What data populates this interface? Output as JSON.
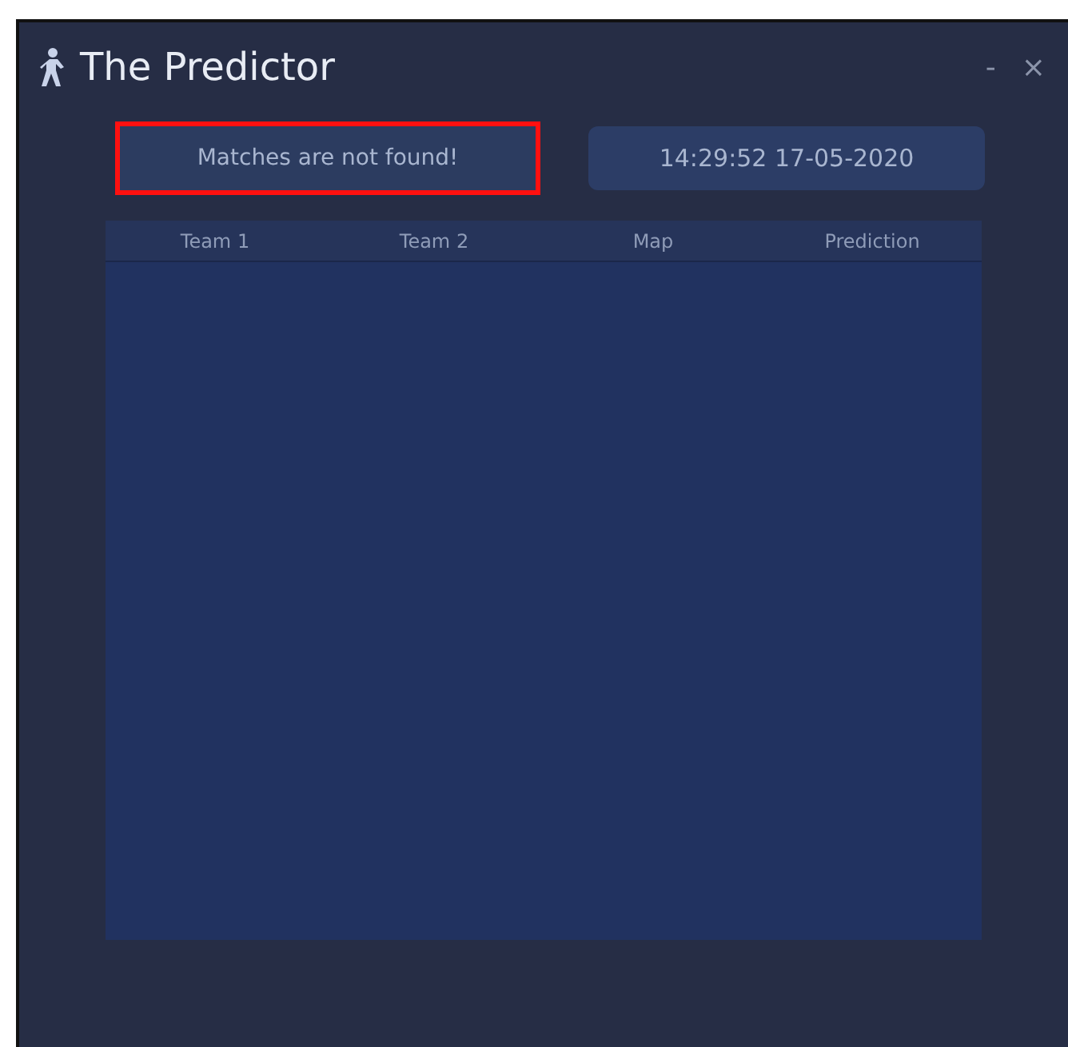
{
  "window": {
    "title": "The Predictor",
    "controls": [
      "-",
      "×"
    ]
  },
  "status": {
    "text": "Matches are not found!",
    "highlighted": true
  },
  "clock": {
    "text": "14:29:52 17-05-2020"
  },
  "table": {
    "columns": [
      "Team 1",
      "Team 2",
      "Map",
      "Prediction"
    ]
  }
}
